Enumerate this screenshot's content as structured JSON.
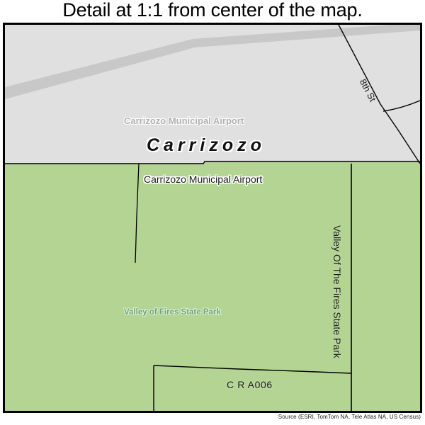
{
  "title": "Detail at 1:1 from center of the map.",
  "map": {
    "labels": {
      "airport_polygon": "Carrizozo Municipal Airport",
      "city": "Carrizozo",
      "airport_boundary": "Carrizozo Municipal Airport",
      "park_area": "Valley of Fires State Park",
      "park_boundary": "Valley Of The Fires State Park",
      "county_road": "C R A006",
      "street": "8th St"
    },
    "colors": {
      "urban_fill": "#e0e0e0",
      "park_fill": "#b3d493",
      "road_band": "#c8c8c8",
      "line": "#000000",
      "park_label": "#6ba47f",
      "polygon_label": "#b0b0b0",
      "border": "#000000"
    }
  },
  "attribution": "Source (ESRI, TomTom NA, Tele Atlas NA, US Census)"
}
